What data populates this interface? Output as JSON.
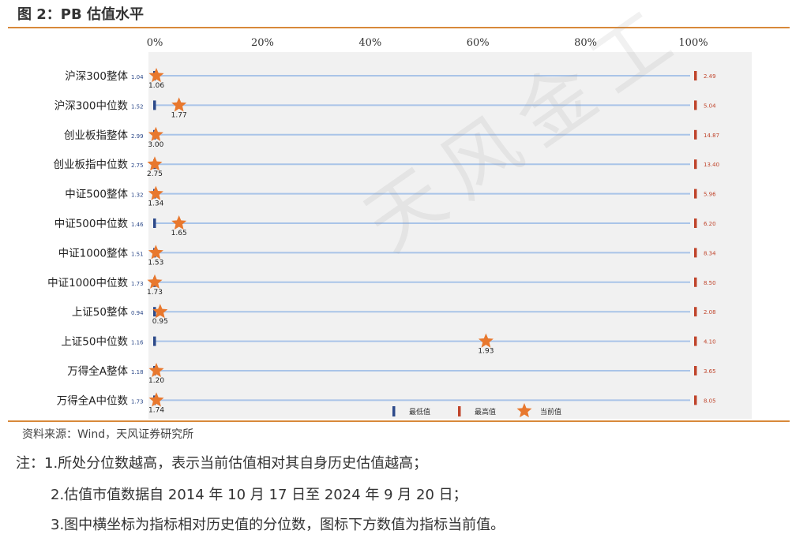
{
  "title": "图 2：PB 估值水平",
  "watermark": "天风金工",
  "source": "资料来源：Wind，天风证券研究所",
  "notes": [
    "注：1.所处分位数越高，表示当前估值相对其自身历史估值越高；",
    "2.估值市值数据自 2014 年 10 月 17 日至 2024 年 9 月 20 日；",
    "3.图中横坐标为指标相对历史值的分位数，图标下方数值为指标当前值。"
  ],
  "colors": {
    "min_marker": "#2d4a8a",
    "max_marker": "#c0452c",
    "current_marker": "#e8782e",
    "range_line": "#a9c4e8",
    "plot_bg": "#f1f1f1"
  },
  "chart_data": {
    "type": "scatter",
    "x_axis": {
      "range": [
        0,
        100
      ],
      "ticks": [
        "0%",
        "20%",
        "40%",
        "60%",
        "80%",
        "100%"
      ],
      "position": "top"
    },
    "legend": {
      "placement": "bottom",
      "entries": [
        {
          "label": "最低值",
          "marker": "min-bar-icon"
        },
        {
          "label": "最高值",
          "marker": "max-bar-icon"
        },
        {
          "label": "当前值",
          "marker": "star-icon"
        }
      ]
    },
    "rows": [
      {
        "name": "沪深300整体",
        "min": "1.04",
        "max": "2.49",
        "current": "1.06",
        "percentile": 0.3
      },
      {
        "name": "沪深300中位数",
        "min": "1.52",
        "max": "5.04",
        "current": "1.77",
        "percentile": 4.5
      },
      {
        "name": "创业板指整体",
        "min": "2.99",
        "max": "14.87",
        "current": "3.00",
        "percentile": 0.2
      },
      {
        "name": "创业板指中位数",
        "min": "2.75",
        "max": "13.40",
        "current": "2.75",
        "percentile": 0.0
      },
      {
        "name": "中证500整体",
        "min": "1.32",
        "max": "5.96",
        "current": "1.34",
        "percentile": 0.2
      },
      {
        "name": "中证500中位数",
        "min": "1.46",
        "max": "6.20",
        "current": "1.65",
        "percentile": 4.5
      },
      {
        "name": "中证1000整体",
        "min": "1.51",
        "max": "8.34",
        "current": "1.53",
        "percentile": 0.2
      },
      {
        "name": "中证1000中位数",
        "min": "1.73",
        "max": "8.50",
        "current": "1.73",
        "percentile": 0.0
      },
      {
        "name": "上证50整体",
        "min": "0.94",
        "max": "2.08",
        "current": "0.95",
        "percentile": 1.0
      },
      {
        "name": "上证50中位数",
        "min": "1.16",
        "max": "4.10",
        "current": "1.93",
        "percentile": 61.5
      },
      {
        "name": "万得全A整体",
        "min": "1.18",
        "max": "3.65",
        "current": "1.20",
        "percentile": 0.3
      },
      {
        "name": "万得全A中位数",
        "min": "1.73",
        "max": "8.05",
        "current": "1.74",
        "percentile": 0.3
      }
    ]
  }
}
